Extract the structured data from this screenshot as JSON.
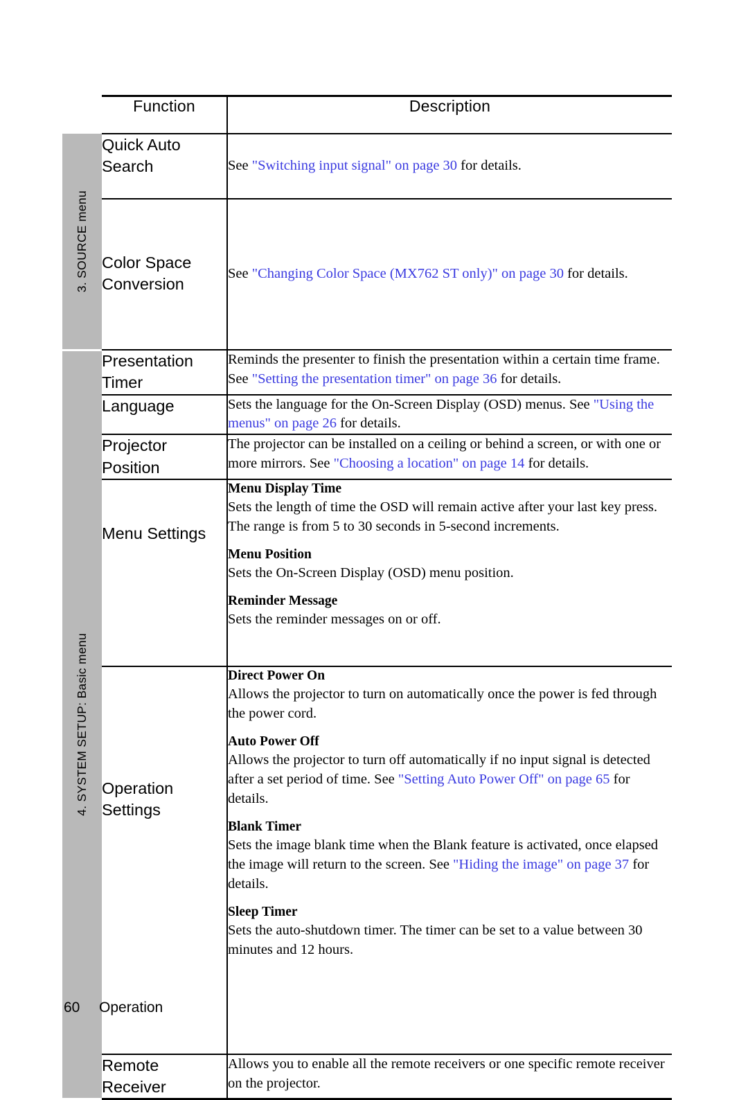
{
  "document": {
    "table_headers": {
      "function": "Function",
      "description": "Description"
    },
    "sections": [
      {
        "side_label": "3. SOURCE menu",
        "rows": [
          {
            "function": "Quick Auto Search",
            "description_parts": [
              {
                "text": "See ",
                "link": false
              },
              {
                "text": "\"Switching input signal\" on page 30",
                "link": true
              },
              {
                "text": " for details.",
                "link": false
              }
            ]
          },
          {
            "function": "Color Space Conversion",
            "description_parts": [
              {
                "text": "See ",
                "link": false
              },
              {
                "text": "\"Changing Color Space (MX762 ST only)\" on page 30",
                "link": true
              },
              {
                "text": " for details.",
                "link": false
              }
            ]
          }
        ]
      },
      {
        "side_label": "4. SYSTEM SETUP: Basic menu",
        "rows": [
          {
            "function": "Presentation Timer",
            "description_parts": [
              {
                "text": "Reminds the presenter to finish the presentation within a certain time frame. See ",
                "link": false
              },
              {
                "text": "\"Setting the presentation timer\" on page 36",
                "link": true
              },
              {
                "text": " for details.",
                "link": false
              }
            ]
          },
          {
            "function": "Language",
            "description_parts": [
              {
                "text": "Sets the language for the On-Screen Display (OSD) menus. See ",
                "link": false
              },
              {
                "text": "\"Using the menus\" on page 26",
                "link": true
              },
              {
                "text": " for details.",
                "link": false
              }
            ]
          },
          {
            "function": "Projector Position",
            "description_parts": [
              {
                "text": "The projector can be installed on a ceiling or behind a screen, or with one or more mirrors. See ",
                "link": false
              },
              {
                "text": "\"Choosing a location\" on page 14",
                "link": true
              },
              {
                "text": " for details.",
                "link": false
              }
            ]
          },
          {
            "function": "Menu Settings",
            "subitems": [
              {
                "heading": "Menu Display Time",
                "body_parts": [
                  {
                    "text": "Sets the length of time the OSD will remain active after your last key press. The range is from 5 to 30 seconds in 5-second increments.",
                    "link": false
                  }
                ]
              },
              {
                "heading": "Menu Position",
                "body_parts": [
                  {
                    "text": "Sets the On-Screen Display (OSD) menu position.",
                    "link": false
                  }
                ]
              },
              {
                "heading": "Reminder Message",
                "body_parts": [
                  {
                    "text": "Sets the reminder messages on or off.",
                    "link": false
                  }
                ]
              }
            ]
          },
          {
            "function": "Operation Settings",
            "subitems": [
              {
                "heading": "Direct Power On",
                "body_parts": [
                  {
                    "text": "Allows the projector to turn on automatically once the power is fed through the power cord.",
                    "link": false
                  }
                ]
              },
              {
                "heading": "Auto Power Off",
                "body_parts": [
                  {
                    "text": "Allows the projector to turn off automatically if no input signal is detected after a set period of time. See ",
                    "link": false
                  },
                  {
                    "text": "\"Setting Auto Power Off\" on page 65",
                    "link": true
                  },
                  {
                    "text": " for details.",
                    "link": false
                  }
                ]
              },
              {
                "heading": "Blank Timer",
                "body_parts": [
                  {
                    "text": "Sets the image blank time when the Blank feature is activated, once elapsed the image will return to the screen. See ",
                    "link": false
                  },
                  {
                    "text": "\"Hiding the image\" on page 37",
                    "link": true
                  },
                  {
                    "text": " for details.",
                    "link": false
                  }
                ]
              },
              {
                "heading": "Sleep Timer",
                "body_parts": [
                  {
                    "text": "Sets the auto-shutdown timer. The timer can be set to a value between 30 minutes and 12 hours.",
                    "link": false
                  }
                ]
              }
            ]
          },
          {
            "function": "Remote Receiver",
            "description_parts": [
              {
                "text": "Allows you to enable all the remote receivers or one specific remote receiver on the projector.",
                "link": false
              }
            ]
          }
        ]
      }
    ]
  },
  "footer": {
    "page_number": "60",
    "chapter": "Operation"
  },
  "colors": {
    "link": "#3a3ae0",
    "section_band": "#b9b9b9",
    "rule": "#000000"
  }
}
